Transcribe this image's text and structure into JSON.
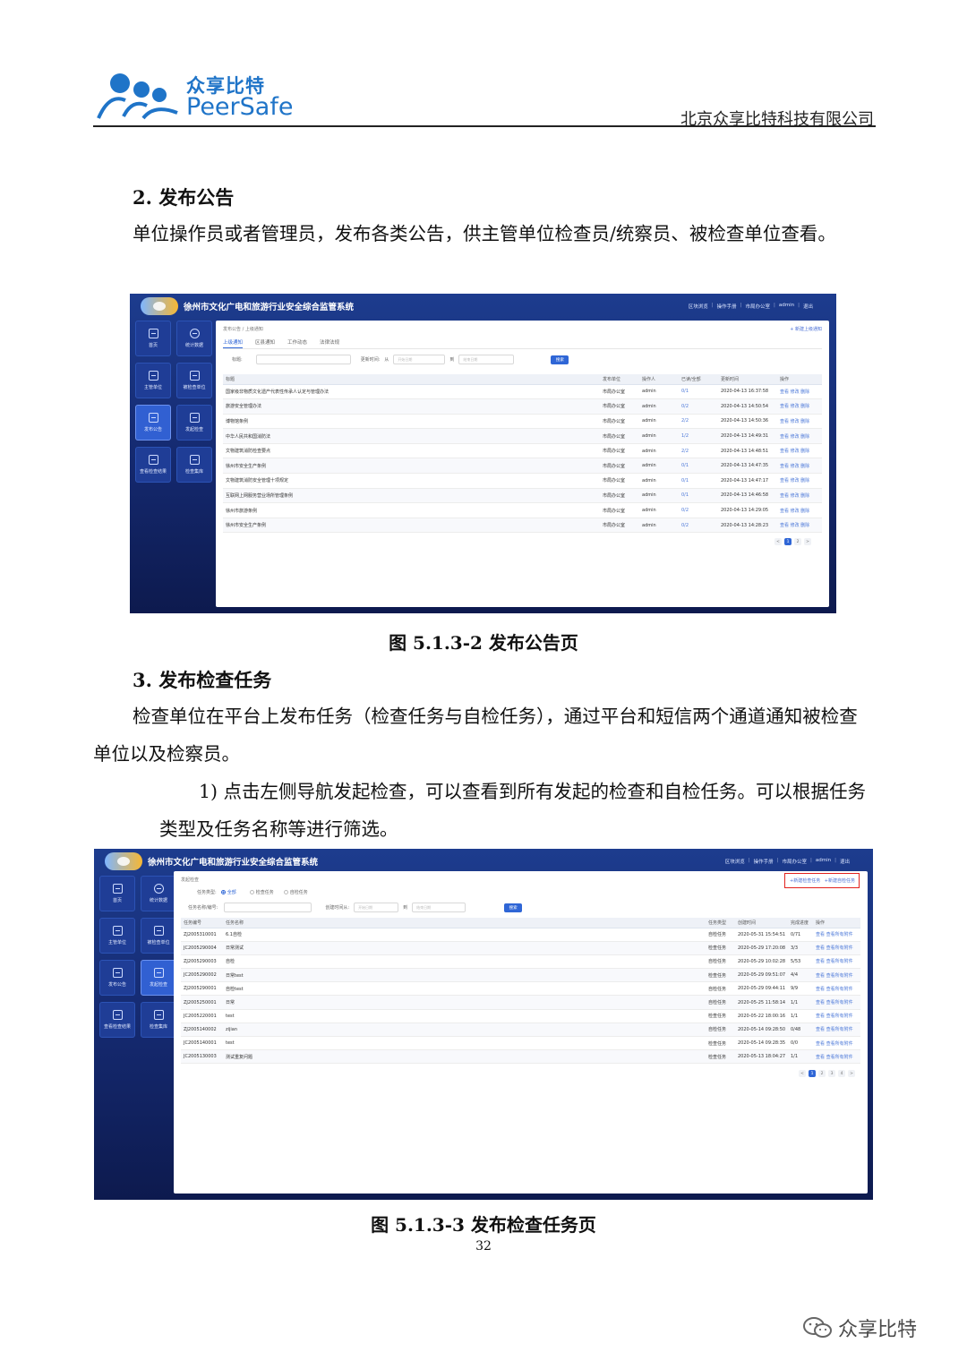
{
  "header": {
    "logo_cn": "众享比特",
    "logo_en": "PeerSafe",
    "company": "北京众享比特科技有限公司"
  },
  "section2": {
    "heading": "2. 发布公告",
    "para": "单位操作员或者管理员，发布各类公告，供主管单位检查员/统察员、被检查单位查看。",
    "caption": "图 5.1.3-2 发布公告页"
  },
  "section3": {
    "heading": "3. 发布检查任务",
    "para": "检查单位在平台上发布任务（检查任务与自检任务），通过平台和短信两个通道通知被检查单位以及检察员。",
    "step1": "1) 点击左侧导航发起检查，可以查看到所有发起的检查和自检任务。可以根据任务类型及任务名称等进行筛选。",
    "caption": "图 5.1.3-3 发布检查任务页"
  },
  "page_number": "32",
  "watermark": "众享比特",
  "app": {
    "title": "徐州市文化广电和旅游行业安全综合监管系统",
    "toplinks": [
      "区块浏览",
      "操作手册",
      "市局办公室",
      "admin",
      "退出"
    ],
    "nav": [
      {
        "label": "首页",
        "icon": "home-icon"
      },
      {
        "label": "统计数据",
        "icon": "chart-icon"
      },
      {
        "label": "主管单位",
        "icon": "building-icon"
      },
      {
        "label": "被检查单位",
        "icon": "office-icon"
      },
      {
        "label": "发布公告",
        "icon": "monitor-icon"
      },
      {
        "label": "发起检查",
        "icon": "clipboard-icon"
      },
      {
        "label": "查看检查结果",
        "icon": "check-icon"
      },
      {
        "label": "检查集库",
        "icon": "calendar-icon"
      }
    ]
  },
  "shot1": {
    "breadcrumb": "发布公告 / 上级通知",
    "new_button": "+ 新建上级通知",
    "tabs": [
      "上级通知",
      "区县通知",
      "工作动态",
      "法律法规"
    ],
    "filter": {
      "title_label": "标题:",
      "time_label": "更新时间:",
      "from": "从",
      "to": "到",
      "start_ph": "开始日期",
      "end_ph": "结束日期",
      "search": "搜索"
    },
    "columns": [
      "标题",
      "发布单位",
      "操作人",
      "已读/全部",
      "更新时间",
      "操作"
    ],
    "rows": [
      {
        "title": "国家级非物质文化遗产代表性传承人认定与管理办法",
        "unit": "市局办公室",
        "user": "admin",
        "read": "0/1",
        "time": "2020-04-13 16:37:58"
      },
      {
        "title": "旅游安全管理办法",
        "unit": "市局办公室",
        "user": "admin",
        "read": "0/2",
        "time": "2020-04-13 14:50:54"
      },
      {
        "title": "博物馆条例",
        "unit": "市局办公室",
        "user": "admin",
        "read": "2/2",
        "time": "2020-04-13 14:50:36"
      },
      {
        "title": "中华人民共和国消防法",
        "unit": "市局办公室",
        "user": "admin",
        "read": "1/2",
        "time": "2020-04-13 14:49:31"
      },
      {
        "title": "文物建筑消防检查要点",
        "unit": "市局办公室",
        "user": "admin",
        "read": "2/2",
        "time": "2020-04-13 14:48:51"
      },
      {
        "title": "徐州市安全生产条例",
        "unit": "市局办公室",
        "user": "admin",
        "read": "0/1",
        "time": "2020-04-13 14:47:35"
      },
      {
        "title": "文物建筑消防安全管理十项规定",
        "unit": "市局办公室",
        "user": "admin",
        "read": "0/1",
        "time": "2020-04-13 14:47:17"
      },
      {
        "title": "互联网上网服务营业场所管理条例",
        "unit": "市局办公室",
        "user": "admin",
        "read": "0/1",
        "time": "2020-04-13 14:46:58"
      },
      {
        "title": "徐州市旅游条例",
        "unit": "市局办公室",
        "user": "admin",
        "read": "0/2",
        "time": "2020-04-13 14:29:05"
      },
      {
        "title": "徐州市安全生产条例",
        "unit": "市局办公室",
        "user": "admin",
        "read": "0/2",
        "time": "2020-04-13 14:28:23"
      }
    ],
    "row_ops": "查看 修改 删除",
    "pages": [
      "<",
      "1",
      "2",
      ">"
    ]
  },
  "shot2": {
    "breadcrumb": "发起检查",
    "buttons": [
      "+新建检查任务",
      "+新建自检任务"
    ],
    "filter": {
      "type_label": "任务类型:",
      "opt_all": "全部",
      "opt_check": "检查任务",
      "opt_self": "自检任务",
      "name_label": "任务名称/编号:",
      "time_label": "创建时间从:",
      "to": "到",
      "start_ph": "开始日期",
      "end_ph": "结束日期",
      "search": "搜索"
    },
    "columns": [
      "任务编号",
      "任务名称",
      "任务类型",
      "创建时间",
      "完成进度",
      "操作"
    ],
    "rows": [
      {
        "id": "ZJ2005310001",
        "name": "6.1自检",
        "type": "自检任务",
        "time": "2020-05-31 15:54:51",
        "progress": "0/71"
      },
      {
        "id": "JC2005290004",
        "name": "日常测试",
        "type": "检查任务",
        "time": "2020-05-29 17:20:08",
        "progress": "3/3"
      },
      {
        "id": "ZJ2005290003",
        "name": "自检",
        "type": "自检任务",
        "time": "2020-05-29 10:02:28",
        "progress": "5/53"
      },
      {
        "id": "JC2005290002",
        "name": "日常test",
        "type": "检查任务",
        "time": "2020-05-29 09:51:07",
        "progress": "4/4"
      },
      {
        "id": "ZJ2005290001",
        "name": "自检test",
        "type": "自检任务",
        "time": "2020-05-29 09:44:11",
        "progress": "9/9"
      },
      {
        "id": "ZJ2005250001",
        "name": "日常",
        "type": "自检任务",
        "time": "2020-05-25 11:58:14",
        "progress": "1/1"
      },
      {
        "id": "JC2005220001",
        "name": "test",
        "type": "检查任务",
        "time": "2020-05-22 18:00:16",
        "progress": "1/1"
      },
      {
        "id": "ZJ2005140002",
        "name": "zijian",
        "type": "自检任务",
        "time": "2020-05-14 09:28:50",
        "progress": "0/48"
      },
      {
        "id": "JC2005140001",
        "name": "test",
        "type": "检查任务",
        "time": "2020-05-14 09:28:35",
        "progress": "0/0"
      },
      {
        "id": "JC2005130003",
        "name": "测试重复问题",
        "type": "检查任务",
        "time": "2020-05-13 18:04:27",
        "progress": "1/1"
      }
    ],
    "row_ops": "查看 查看所有附件",
    "pages": [
      "<",
      "1",
      "2",
      "3",
      "4",
      ">"
    ]
  },
  "colors": {
    "accent": "#2f66d6",
    "nav_bg": "#14286d",
    "brand": "#1f74c8",
    "highlight": "#e3221d"
  }
}
